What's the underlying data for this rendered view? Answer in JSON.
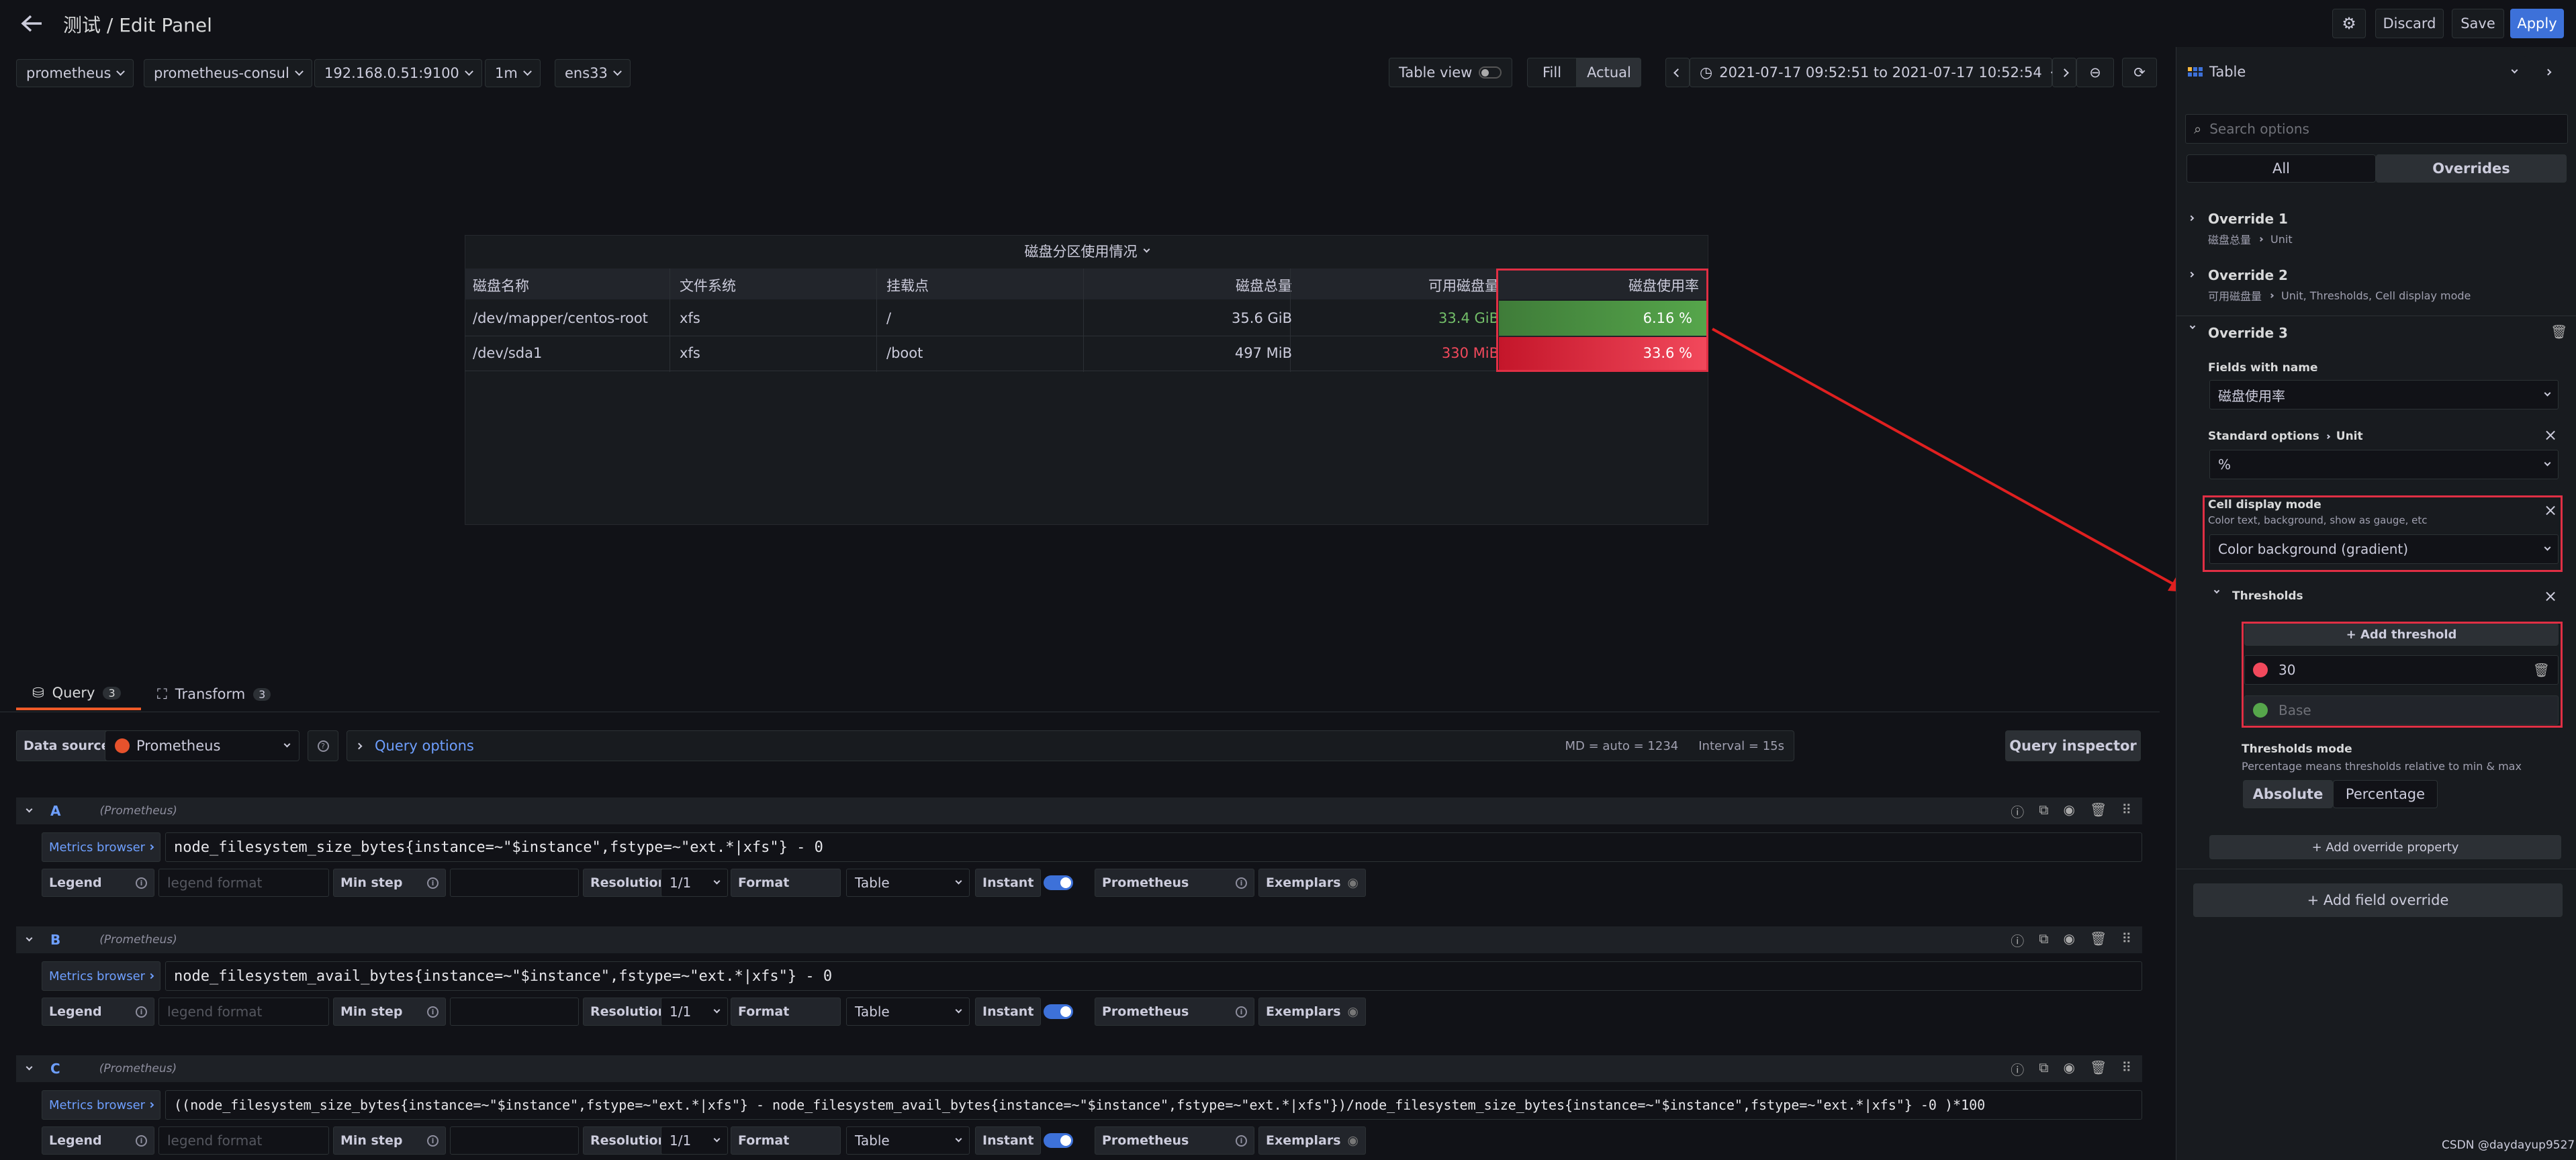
{
  "header": {
    "title": "测试 / Edit Panel",
    "discard": "Discard",
    "save": "Save",
    "apply": "Apply"
  },
  "variables": [
    {
      "value": "prometheus"
    },
    {
      "value": "prometheus-consul"
    },
    {
      "value": "192.168.0.51:9100"
    },
    {
      "value": "1m"
    },
    {
      "value": "ens33"
    }
  ],
  "toolbar": {
    "table_view": "Table view",
    "fill": "Fill",
    "actual": "Actual",
    "time_range": "2021-07-17 09:52:51 to 2021-07-17 10:52:54"
  },
  "viz": {
    "name": "Table"
  },
  "panel": {
    "title": "磁盘分区使用情况",
    "columns": [
      "磁盘名称",
      "文件系统",
      "挂载点",
      "磁盘总量",
      "可用磁盘量",
      "磁盘使用率"
    ],
    "rows": [
      [
        "/dev/mapper/centos-root",
        "xfs",
        "/",
        "35.6 GiB",
        "33.4 GiB",
        "6.16 %"
      ],
      [
        "/dev/sda1",
        "xfs",
        "/boot",
        "497 MiB",
        "330 MiB",
        "33.6 %"
      ]
    ],
    "colors": {
      "green": "#56a64b",
      "red": "#e02f44"
    }
  },
  "tabs": [
    {
      "label": "Query",
      "count": "3"
    },
    {
      "label": "Transform",
      "count": "3"
    }
  ],
  "query_bar": {
    "data_source_label": "Data source",
    "data_source": "Prometheus",
    "query_options": "Query options",
    "md": "MD = auto = 1234",
    "interval": "Interval = 15s",
    "inspector": "Query inspector"
  },
  "query_labels": {
    "metrics_browser": "Metrics browser",
    "legend": "Legend",
    "legend_placeholder": "legend format",
    "min_step": "Min step",
    "resolution": "Resolution",
    "resolution_value": "1/1",
    "format": "Format",
    "format_value": "Table",
    "instant": "Instant",
    "prometheus": "Prometheus",
    "exemplars": "Exemplars",
    "source_tag": "(Prometheus)"
  },
  "queries": [
    {
      "ref": "A",
      "expr": "node_filesystem_size_bytes{instance=~\"$instance\",fstype=~\"ext.*|xfs\"} - 0"
    },
    {
      "ref": "B",
      "expr": "node_filesystem_avail_bytes{instance=~\"$instance\",fstype=~\"ext.*|xfs\"} - 0"
    },
    {
      "ref": "C",
      "expr": "((node_filesystem_size_bytes{instance=~\"$instance\",fstype=~\"ext.*|xfs\"} - node_filesystem_avail_bytes{instance=~\"$instance\",fstype=~\"ext.*|xfs\"})/node_filesystem_size_bytes{instance=~\"$instance\",fstype=~\"ext.*|xfs\"} -0 )*100"
    }
  ],
  "options": {
    "search_placeholder": "Search options",
    "tab_all": "All",
    "tab_overrides": "Overrides",
    "override1": {
      "title": "Override 1",
      "field": "磁盘总量",
      "props": "Unit"
    },
    "override2": {
      "title": "Override 2",
      "field": "可用磁盘量",
      "props": "Unit, Thresholds, Cell display mode"
    },
    "override3": {
      "title": "Override 3",
      "fields_label": "Fields with name",
      "field": "磁盘使用率",
      "std_label": "Standard options",
      "unit_label": "Unit",
      "unit_value": "%",
      "cell_mode_label": "Cell display mode",
      "cell_mode_desc": "Color text, background, show as gauge, etc",
      "cell_mode_value": "Color background (gradient)",
      "thresholds_label": "Thresholds",
      "add_threshold": "+ Add threshold",
      "threshold_value": "30",
      "base_value": "Base",
      "mode_label": "Thresholds mode",
      "mode_desc": "Percentage means thresholds relative to min & max",
      "absolute": "Absolute",
      "percentage": "Percentage",
      "add_property": "+ Add override property"
    },
    "add_field_override": "+ Add field override"
  },
  "watermark": "CSDN @daydayup9527"
}
